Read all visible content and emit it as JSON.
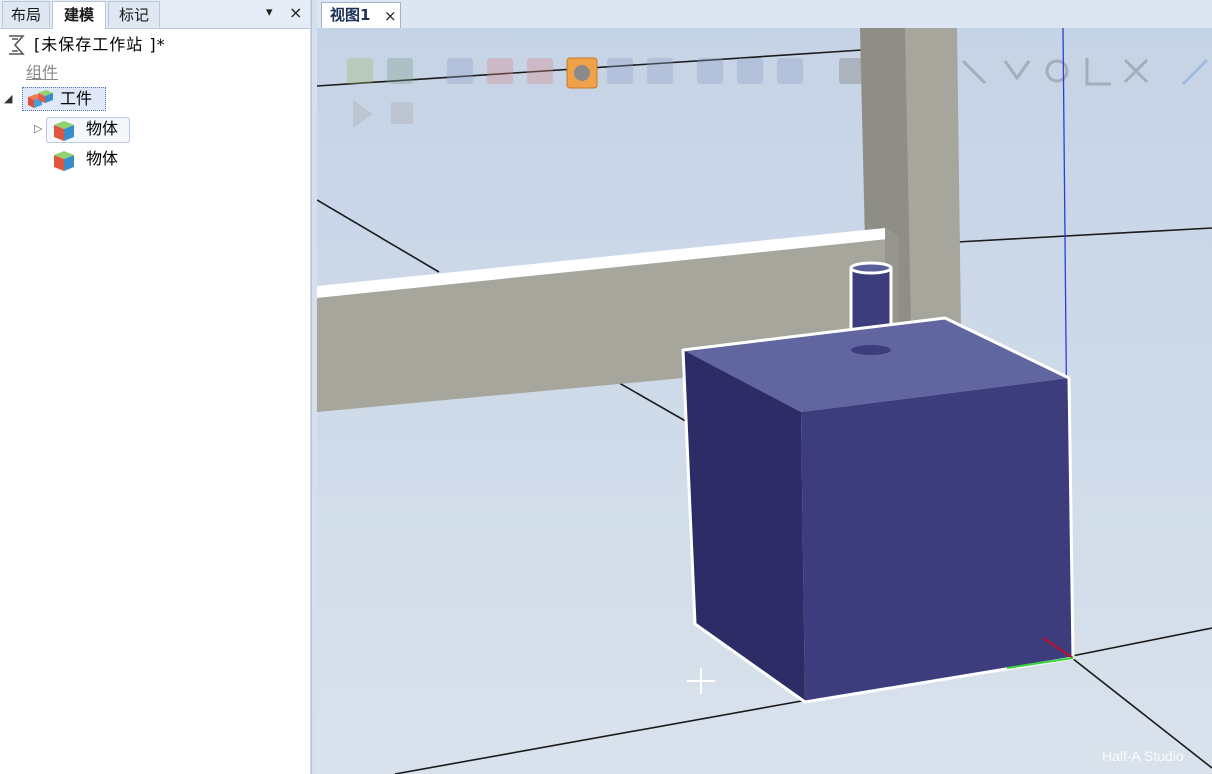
{
  "left_panel": {
    "tabs": [
      {
        "label": "布局",
        "active": false
      },
      {
        "label": "建模",
        "active": true
      },
      {
        "label": "标记",
        "active": false
      }
    ],
    "pin_icon": "▾",
    "close_icon": "×",
    "tree": {
      "station_label": "[未保存工作站 ]*",
      "group_label": "组件",
      "workpiece_label": "工件",
      "body1_label": "物体",
      "body2_label": "物体",
      "expand_open_glyph": "◢",
      "expand_closed_glyph": "▷"
    }
  },
  "view": {
    "tab_label": "视图1",
    "tab_close": "×",
    "watermark": "Half-A Studio"
  },
  "colors": {
    "viewport_bg_top": "#c5d3e6",
    "viewport_bg_bottom": "#d9e2ec",
    "box_top": "#6266a0",
    "box_front": "#3d3d7e",
    "box_left": "#2e2c66",
    "beam_gray": "#a6a69d",
    "column_gray": "#8e8e86"
  }
}
